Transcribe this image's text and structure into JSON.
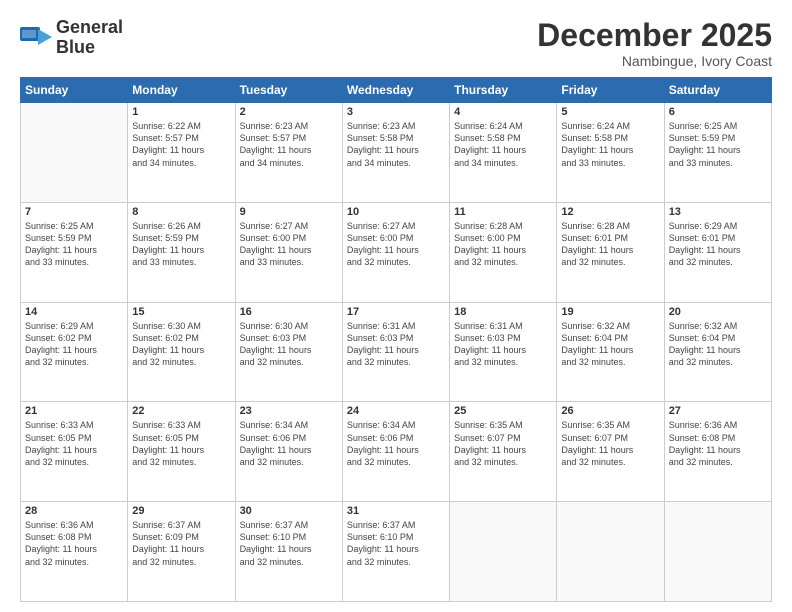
{
  "header": {
    "logo": {
      "general": "General",
      "blue": "Blue"
    },
    "title": "December 2025",
    "location": "Nambingue, Ivory Coast"
  },
  "calendar": {
    "days_of_week": [
      "Sunday",
      "Monday",
      "Tuesday",
      "Wednesday",
      "Thursday",
      "Friday",
      "Saturday"
    ],
    "weeks": [
      [
        {
          "day": "",
          "info": ""
        },
        {
          "day": "1",
          "info": "Sunrise: 6:22 AM\nSunset: 5:57 PM\nDaylight: 11 hours\nand 34 minutes."
        },
        {
          "day": "2",
          "info": "Sunrise: 6:23 AM\nSunset: 5:57 PM\nDaylight: 11 hours\nand 34 minutes."
        },
        {
          "day": "3",
          "info": "Sunrise: 6:23 AM\nSunset: 5:58 PM\nDaylight: 11 hours\nand 34 minutes."
        },
        {
          "day": "4",
          "info": "Sunrise: 6:24 AM\nSunset: 5:58 PM\nDaylight: 11 hours\nand 34 minutes."
        },
        {
          "day": "5",
          "info": "Sunrise: 6:24 AM\nSunset: 5:58 PM\nDaylight: 11 hours\nand 33 minutes."
        },
        {
          "day": "6",
          "info": "Sunrise: 6:25 AM\nSunset: 5:59 PM\nDaylight: 11 hours\nand 33 minutes."
        }
      ],
      [
        {
          "day": "7",
          "info": "Sunrise: 6:25 AM\nSunset: 5:59 PM\nDaylight: 11 hours\nand 33 minutes."
        },
        {
          "day": "8",
          "info": "Sunrise: 6:26 AM\nSunset: 5:59 PM\nDaylight: 11 hours\nand 33 minutes."
        },
        {
          "day": "9",
          "info": "Sunrise: 6:27 AM\nSunset: 6:00 PM\nDaylight: 11 hours\nand 33 minutes."
        },
        {
          "day": "10",
          "info": "Sunrise: 6:27 AM\nSunset: 6:00 PM\nDaylight: 11 hours\nand 32 minutes."
        },
        {
          "day": "11",
          "info": "Sunrise: 6:28 AM\nSunset: 6:00 PM\nDaylight: 11 hours\nand 32 minutes."
        },
        {
          "day": "12",
          "info": "Sunrise: 6:28 AM\nSunset: 6:01 PM\nDaylight: 11 hours\nand 32 minutes."
        },
        {
          "day": "13",
          "info": "Sunrise: 6:29 AM\nSunset: 6:01 PM\nDaylight: 11 hours\nand 32 minutes."
        }
      ],
      [
        {
          "day": "14",
          "info": "Sunrise: 6:29 AM\nSunset: 6:02 PM\nDaylight: 11 hours\nand 32 minutes."
        },
        {
          "day": "15",
          "info": "Sunrise: 6:30 AM\nSunset: 6:02 PM\nDaylight: 11 hours\nand 32 minutes."
        },
        {
          "day": "16",
          "info": "Sunrise: 6:30 AM\nSunset: 6:03 PM\nDaylight: 11 hours\nand 32 minutes."
        },
        {
          "day": "17",
          "info": "Sunrise: 6:31 AM\nSunset: 6:03 PM\nDaylight: 11 hours\nand 32 minutes."
        },
        {
          "day": "18",
          "info": "Sunrise: 6:31 AM\nSunset: 6:03 PM\nDaylight: 11 hours\nand 32 minutes."
        },
        {
          "day": "19",
          "info": "Sunrise: 6:32 AM\nSunset: 6:04 PM\nDaylight: 11 hours\nand 32 minutes."
        },
        {
          "day": "20",
          "info": "Sunrise: 6:32 AM\nSunset: 6:04 PM\nDaylight: 11 hours\nand 32 minutes."
        }
      ],
      [
        {
          "day": "21",
          "info": "Sunrise: 6:33 AM\nSunset: 6:05 PM\nDaylight: 11 hours\nand 32 minutes."
        },
        {
          "day": "22",
          "info": "Sunrise: 6:33 AM\nSunset: 6:05 PM\nDaylight: 11 hours\nand 32 minutes."
        },
        {
          "day": "23",
          "info": "Sunrise: 6:34 AM\nSunset: 6:06 PM\nDaylight: 11 hours\nand 32 minutes."
        },
        {
          "day": "24",
          "info": "Sunrise: 6:34 AM\nSunset: 6:06 PM\nDaylight: 11 hours\nand 32 minutes."
        },
        {
          "day": "25",
          "info": "Sunrise: 6:35 AM\nSunset: 6:07 PM\nDaylight: 11 hours\nand 32 minutes."
        },
        {
          "day": "26",
          "info": "Sunrise: 6:35 AM\nSunset: 6:07 PM\nDaylight: 11 hours\nand 32 minutes."
        },
        {
          "day": "27",
          "info": "Sunrise: 6:36 AM\nSunset: 6:08 PM\nDaylight: 11 hours\nand 32 minutes."
        }
      ],
      [
        {
          "day": "28",
          "info": "Sunrise: 6:36 AM\nSunset: 6:08 PM\nDaylight: 11 hours\nand 32 minutes."
        },
        {
          "day": "29",
          "info": "Sunrise: 6:37 AM\nSunset: 6:09 PM\nDaylight: 11 hours\nand 32 minutes."
        },
        {
          "day": "30",
          "info": "Sunrise: 6:37 AM\nSunset: 6:10 PM\nDaylight: 11 hours\nand 32 minutes."
        },
        {
          "day": "31",
          "info": "Sunrise: 6:37 AM\nSunset: 6:10 PM\nDaylight: 11 hours\nand 32 minutes."
        },
        {
          "day": "",
          "info": ""
        },
        {
          "day": "",
          "info": ""
        },
        {
          "day": "",
          "info": ""
        }
      ]
    ]
  }
}
